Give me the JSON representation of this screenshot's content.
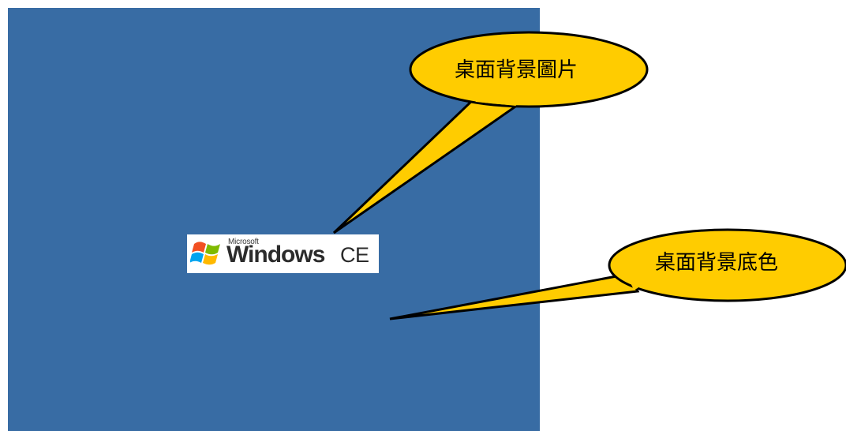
{
  "desktop": {
    "background_color": "#386ca4",
    "wallpaper_logo": {
      "icon": "windows-flag-icon",
      "microsoft_text": "Microsoft",
      "windows_text": "Windows",
      "ce_text": "CE"
    }
  },
  "callouts": [
    {
      "label": "桌面背景圖片",
      "fill_color": "#ffcc00"
    },
    {
      "label": "桌面背景底色",
      "fill_color": "#ffcc00"
    }
  ]
}
